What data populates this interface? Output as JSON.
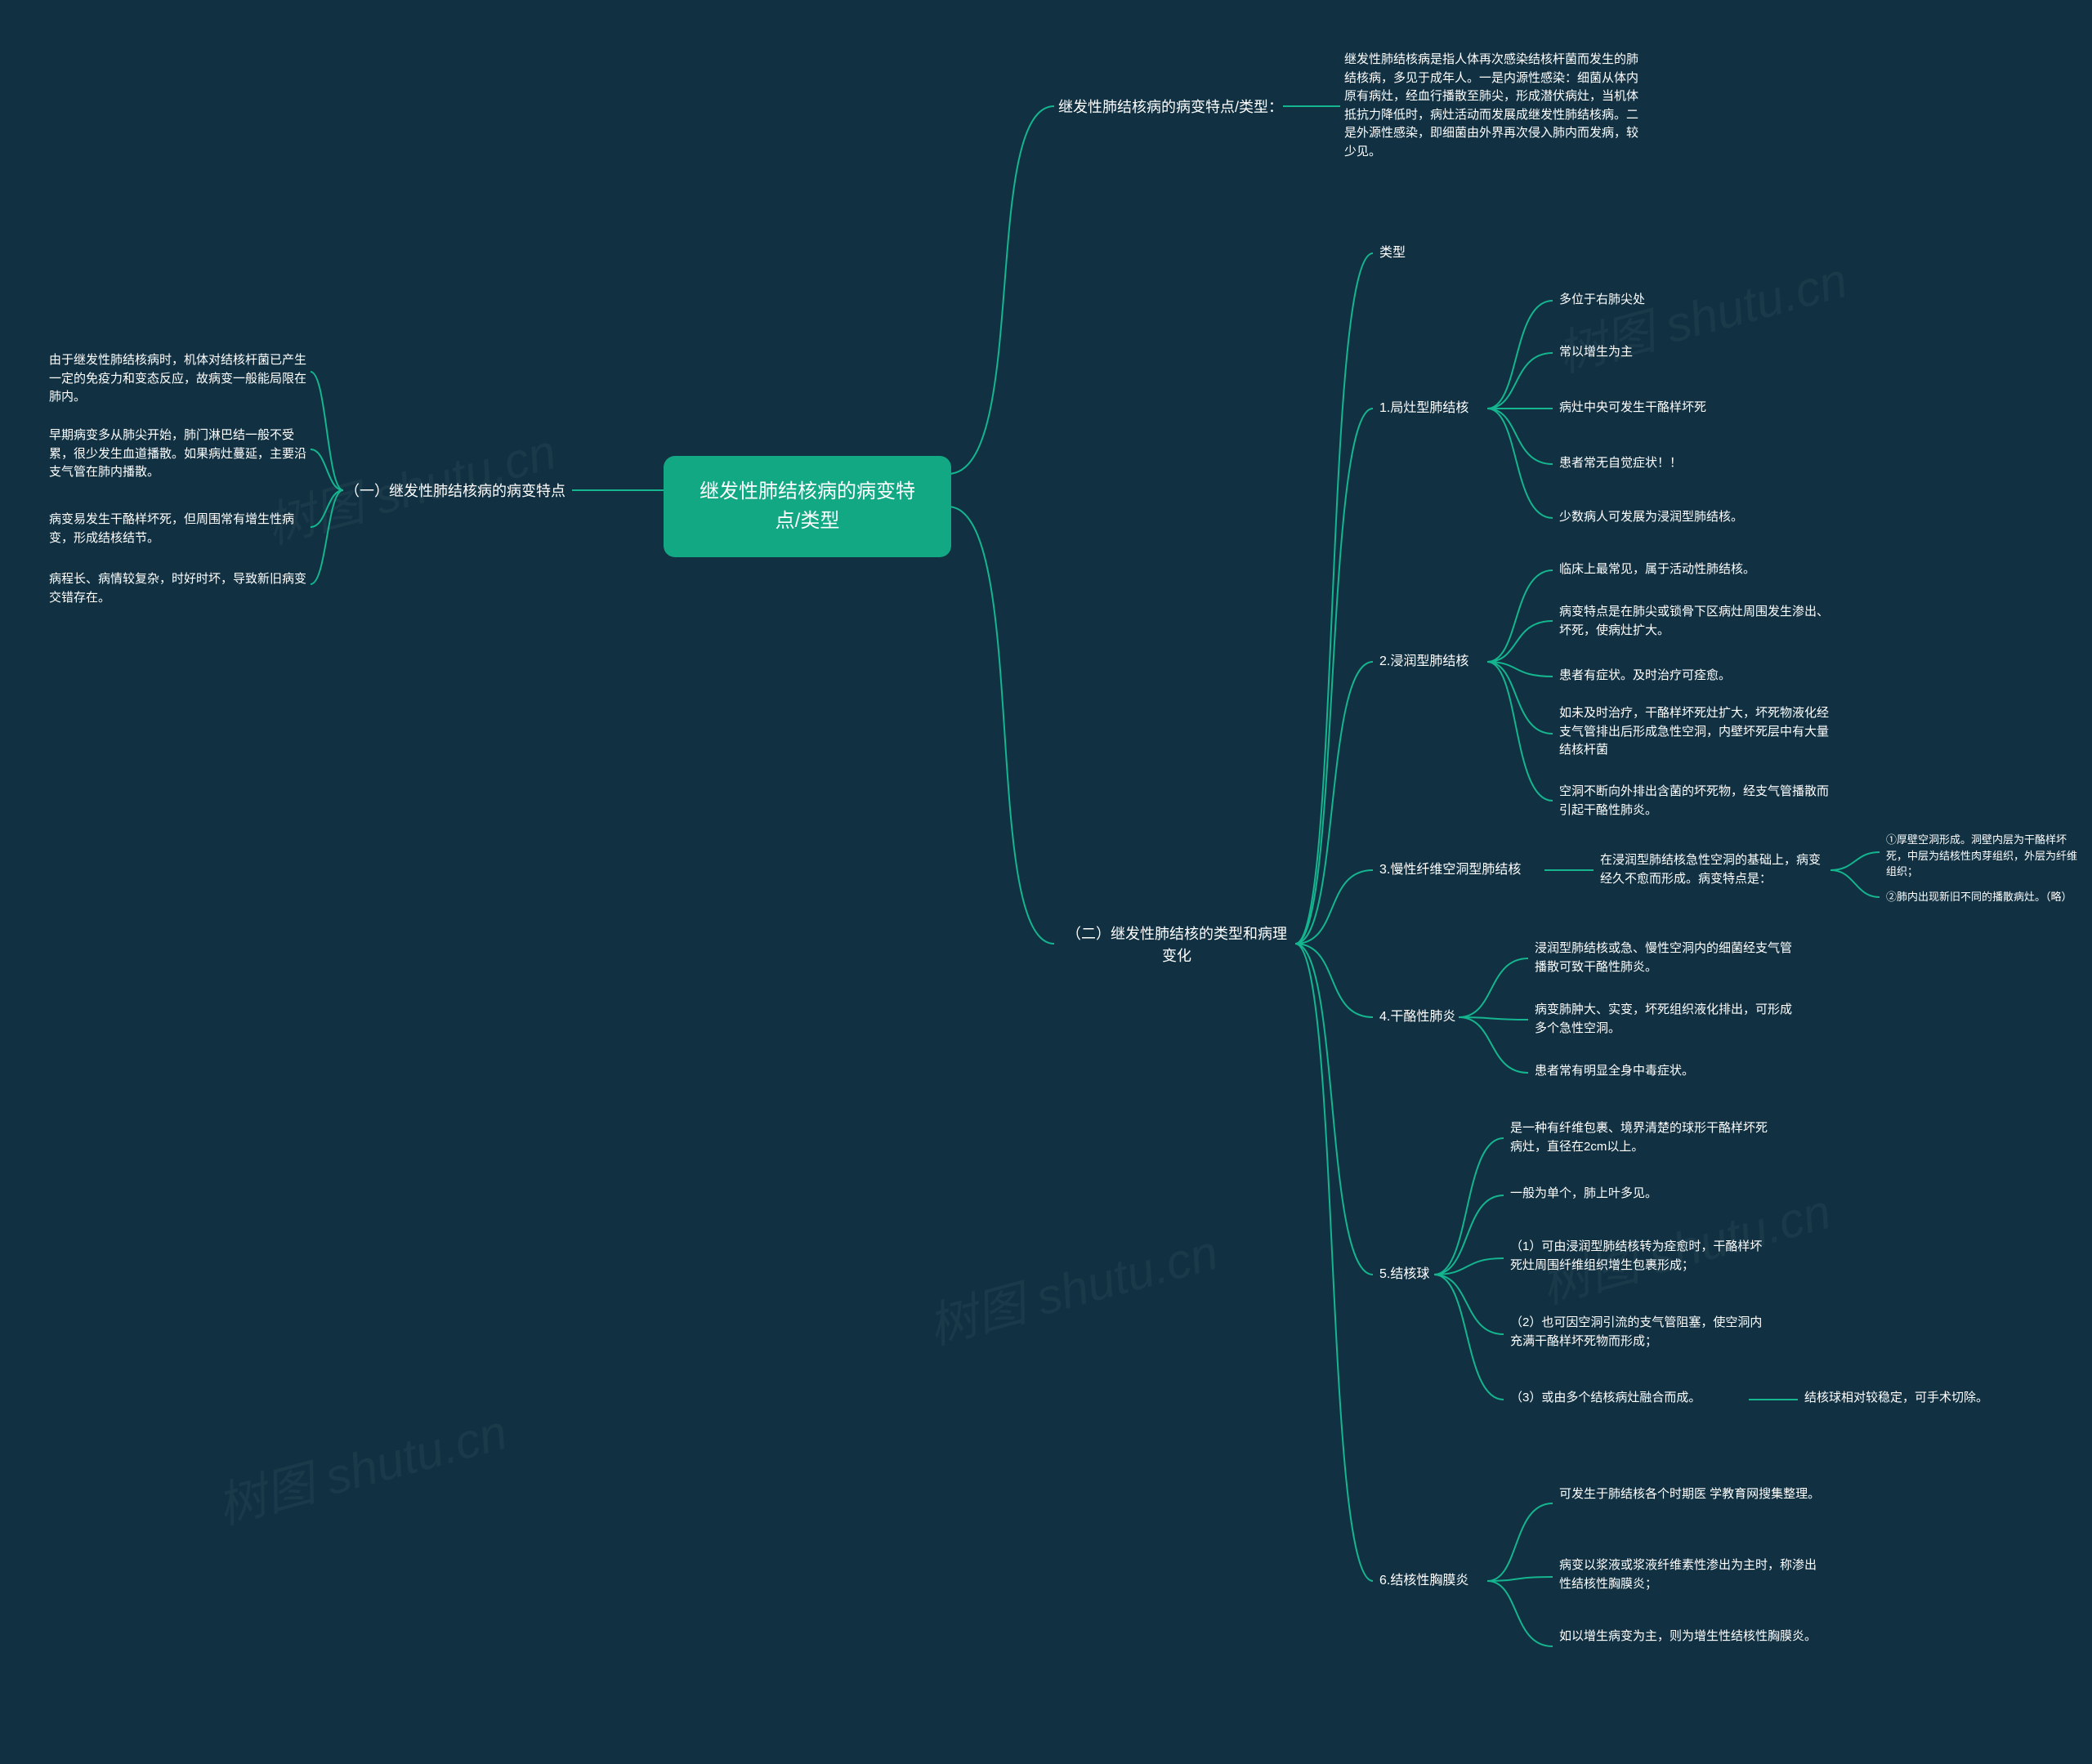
{
  "chart_data": {
    "type": "mindmap",
    "root": "继发性肺结核病的病变特点/类型",
    "children": [
      {
        "label": "继发性肺结核病的病变特点/类型：",
        "children": [
          {
            "label": "继发性肺结核病是指人体再次感染结核杆菌而发生的肺结核病，多见于成年人。一是内源性感染：细菌从体内原有病灶，经血行播散至肺尖，形成潜伏病灶，当机体抵抗力降低时，病灶活动而发展成继发性肺结核病。二是外源性感染，即细菌由外界再次侵入肺内而发病，较少见。"
          }
        ]
      },
      {
        "label": "（一）继发性肺结核病的病变特点",
        "left": true,
        "children": [
          {
            "label": "由于继发性肺结核病时，机体对结核杆菌已产生一定的免疫力和变态反应，故病变一般能局限在肺内。"
          },
          {
            "label": "早期病变多从肺尖开始，肺门淋巴结一般不受累，很少发生血道播散。如果病灶蔓延，主要沿支气管在肺内播散。"
          },
          {
            "label": "病变易发生干酪样坏死，但周围常有增生性病变，形成结核结节。"
          },
          {
            "label": "病程长、病情较复杂，时好时坏，导致新旧病变交错存在。"
          }
        ]
      },
      {
        "label": "（二）继发性肺结核的类型和病理变化",
        "children": [
          {
            "label": "类型"
          },
          {
            "label": "1.局灶型肺结核",
            "children": [
              {
                "label": "多位于右肺尖处"
              },
              {
                "label": "常以增生为主"
              },
              {
                "label": "病灶中央可发生干酪样坏死"
              },
              {
                "label": "患者常无自觉症状！！"
              },
              {
                "label": "少数病人可发展为浸润型肺结核。"
              }
            ]
          },
          {
            "label": "2.浸润型肺结核",
            "children": [
              {
                "label": "临床上最常见，属于活动性肺结核。"
              },
              {
                "label": "病变特点是在肺尖或锁骨下区病灶周围发生渗出、坏死，使病灶扩大。"
              },
              {
                "label": "患者有症状。及时治疗可痊愈。"
              },
              {
                "label": "如未及时治疗，干酪样坏死灶扩大，坏死物液化经支气管排出后形成急性空洞，内壁坏死层中有大量结核杆菌"
              },
              {
                "label": "空洞不断向外排出含菌的坏死物，经支气管播散而引起干酪性肺炎。"
              }
            ]
          },
          {
            "label": "3.慢性纤维空洞型肺结核",
            "children": [
              {
                "label": "在浸润型肺结核急性空洞的基础上，病变经久不愈而形成。病变特点是：",
                "children": [
                  {
                    "label": "①厚壁空洞形成。洞壁内层为干酪样坏死，中层为结核性肉芽组织，外层为纤维组织；"
                  },
                  {
                    "label": "②肺内出现新旧不同的播散病灶。（略）"
                  }
                ]
              }
            ]
          },
          {
            "label": "4.干酪性肺炎",
            "children": [
              {
                "label": "浸润型肺结核或急、慢性空洞内的细菌经支气管播散可致干酪性肺炎。"
              },
              {
                "label": "病变肺肿大、实变，坏死组织液化排出，可形成多个急性空洞。"
              },
              {
                "label": "患者常有明显全身中毒症状。"
              }
            ]
          },
          {
            "label": "5.结核球",
            "children": [
              {
                "label": "是一种有纤维包裹、境界清楚的球形干酪样坏死病灶，直径在2cm以上。"
              },
              {
                "label": "一般为单个，肺上叶多见。"
              },
              {
                "label": "（1）可由浸润型肺结核转为痊愈时，干酪样坏死灶周围纤维组织增生包裹形成；"
              },
              {
                "label": "（2）也可因空洞引流的支气管阻塞，使空洞内充满干酪样坏死物而形成；"
              },
              {
                "label": "（3）或由多个结核病灶融合而成。",
                "children": [
                  {
                    "label": "结核球相对较稳定，可手术切除。"
                  }
                ]
              }
            ]
          },
          {
            "label": "6.结核性胸膜炎",
            "children": [
              {
                "label": "可发生于肺结核各个时期医 学教育网搜集整理。"
              },
              {
                "label": "病变以浆液或浆液纤维素性渗出为主时，称渗出性结核性胸膜炎；"
              },
              {
                "label": "如以增生病变为主，则为增生性结核性胸膜炎。"
              }
            ]
          }
        ]
      }
    ]
  },
  "root": {
    "line1": "继发性肺结核病的病变特",
    "line2": "点/类型"
  },
  "brA": "继发性肺结核病的病变特点/类型：",
  "brA_desc": "继发性肺结核病是指人体再次感染结核杆菌而发生的肺结核病，多见于成年人。一是内源性感染：细菌从体内原有病灶，经血行播散至肺尖，形成潜伏病灶，当机体抵抗力降低时，病灶活动而发展成继发性肺结核病。二是外源性感染，即细菌由外界再次侵入肺内而发病，较少见。",
  "brB": "（一）继发性肺结核病的病变特点",
  "b1": "由于继发性肺结核病时，机体对结核杆菌已产生一定的免疫力和变态反应，故病变一般能局限在肺内。",
  "b2": "早期病变多从肺尖开始，肺门淋巴结一般不受累，很少发生血道播散。如果病灶蔓延，主要沿支气管在肺内播散。",
  "b3": "病变易发生干酪样坏死，但周围常有增生性病变，形成结核结节。",
  "b4": "病程长、病情较复杂，时好时坏，导致新旧病变交错存在。",
  "brC_line1": "（二）继发性肺结核的类型和病理",
  "brC_line2": "变化",
  "c0": "类型",
  "c1": "1.局灶型肺结核",
  "c1a": "多位于右肺尖处",
  "c1b": "常以增生为主",
  "c1c": "病灶中央可发生干酪样坏死",
  "c1d": "患者常无自觉症状！！",
  "c1e": "少数病人可发展为浸润型肺结核。",
  "c2": "2.浸润型肺结核",
  "c2a": "临床上最常见，属于活动性肺结核。",
  "c2b": "病变特点是在肺尖或锁骨下区病灶周围发生渗出、坏死，使病灶扩大。",
  "c2c": "患者有症状。及时治疗可痊愈。",
  "c2d": "如未及时治疗，干酪样坏死灶扩大，坏死物液化经支气管排出后形成急性空洞，内壁坏死层中有大量结核杆菌",
  "c2e": "空洞不断向外排出含菌的坏死物，经支气管播散而引起干酪性肺炎。",
  "c3": "3.慢性纤维空洞型肺结核",
  "c3a": "在浸润型肺结核急性空洞的基础上，病变经久不愈而形成。病变特点是：",
  "c3a1": "①厚壁空洞形成。洞壁内层为干酪样坏死，中层为结核性肉芽组织，外层为纤维组织；",
  "c3a2": "②肺内出现新旧不同的播散病灶。（略）",
  "c4": "4.干酪性肺炎",
  "c4a": "浸润型肺结核或急、慢性空洞内的细菌经支气管播散可致干酪性肺炎。",
  "c4b": "病变肺肿大、实变，坏死组织液化排出，可形成多个急性空洞。",
  "c4c": "患者常有明显全身中毒症状。",
  "c5": "5.结核球",
  "c5a": "是一种有纤维包裹、境界清楚的球形干酪样坏死病灶，直径在2cm以上。",
  "c5b": "一般为单个，肺上叶多见。",
  "c5c": "（1）可由浸润型肺结核转为痊愈时，干酪样坏死灶周围纤维组织增生包裹形成；",
  "c5d": "（2）也可因空洞引流的支气管阻塞，使空洞内充满干酪样坏死物而形成；",
  "c5e": "（3）或由多个结核病灶融合而成。",
  "c5e1": "结核球相对较稳定，可手术切除。",
  "c6": "6.结核性胸膜炎",
  "c6a": "可发生于肺结核各个时期医 学教育网搜集整理。",
  "c6b": "病变以浆液或浆液纤维素性渗出为主时，称渗出性结核性胸膜炎；",
  "c6c": "如以增生病变为主，则为增生性结核性胸膜炎。",
  "wm": "树图 shutu.cn"
}
